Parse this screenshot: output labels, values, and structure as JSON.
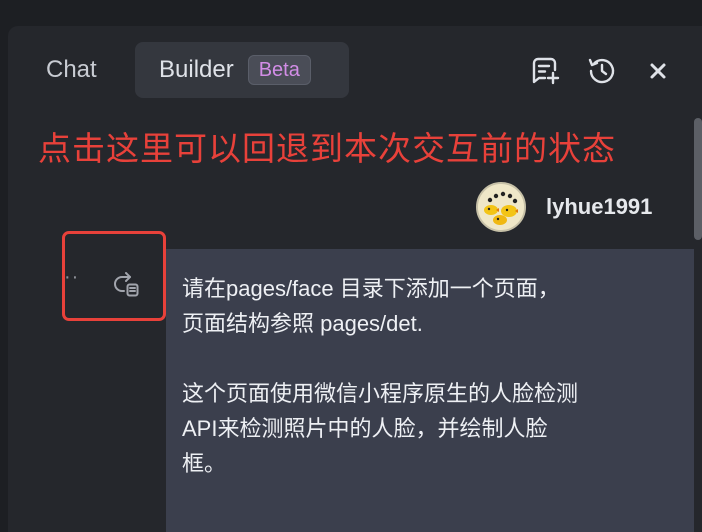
{
  "header": {
    "tabs": [
      {
        "label": "Chat",
        "active": false
      },
      {
        "label": "Builder",
        "active": true,
        "badge": "Beta"
      }
    ],
    "icons": [
      "new-chat-icon",
      "history-icon",
      "close-icon"
    ]
  },
  "annotation": {
    "text": "点击这里可以回退到本次交互前的状态",
    "color": "#e8413a"
  },
  "message": {
    "username": "lyhue1991",
    "avatar": "avatar-icon",
    "actions": [
      "more-icon",
      "revert-icon"
    ],
    "paragraphs": [
      [
        "请在pages/face 目录下添加一个页面，",
        "页面结构参照 pages/det."
      ],
      [
        "这个页面使用微信小程序原生的人脸检测",
        "API来检测照片中的人脸，并绘制人脸",
        "框。"
      ]
    ]
  },
  "colors": {
    "accent": "#d28de6",
    "highlight": "#e8413a",
    "bubble": "#3b3f4d"
  }
}
